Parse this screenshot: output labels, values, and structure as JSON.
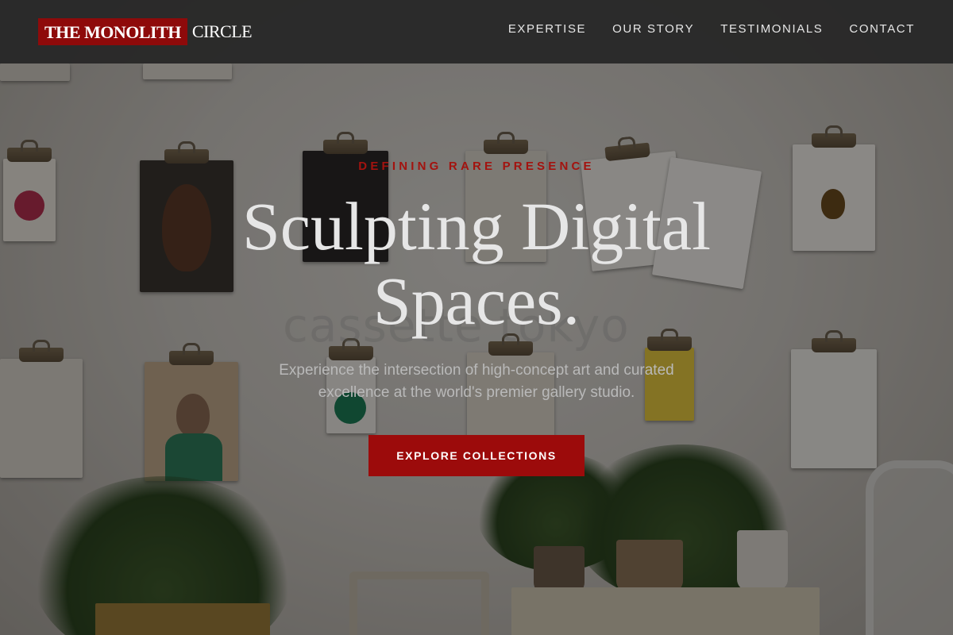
{
  "brand": {
    "logo_mark": "THE MONOLITH",
    "logo_rest": "CIRCLE",
    "accent_color": "#9c0b0b"
  },
  "nav": {
    "items": [
      {
        "label": "EXPERTISE"
      },
      {
        "label": "OUR STORY"
      },
      {
        "label": "TESTIMONIALS"
      },
      {
        "label": "CONTACT"
      }
    ]
  },
  "hero": {
    "eyebrow": "DEFINING RARE PRESENCE",
    "headline_line1": "Sculpting Digital",
    "headline_line2": "Spaces.",
    "subtext_line1": "Experience the intersection of high-concept art and curated",
    "subtext_line2": "excellence at the world's premier gallery studio.",
    "cta_label": "EXPLORE COLLECTIONS"
  }
}
